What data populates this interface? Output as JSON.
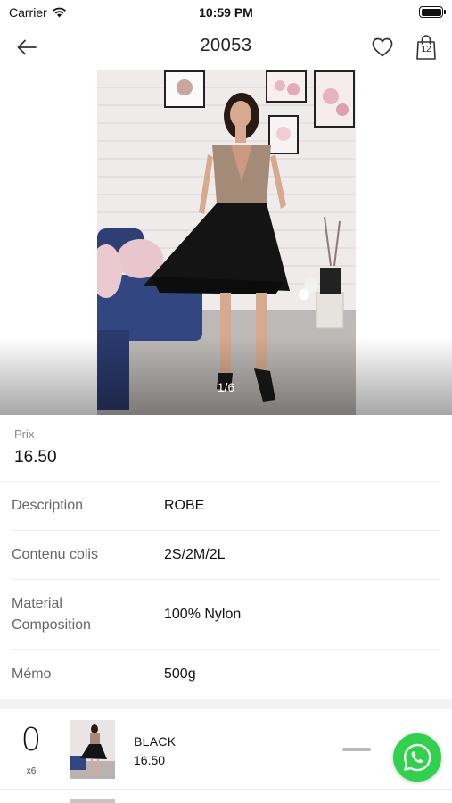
{
  "status_bar": {
    "carrier": "Carrier",
    "time": "10:59 PM"
  },
  "nav": {
    "title": "20053",
    "cart_count": "12"
  },
  "gallery": {
    "counter": "1/6"
  },
  "product": {
    "price_label": "Prix",
    "price_value": "16.50",
    "attributes": [
      {
        "key": "Description",
        "value": "ROBE"
      },
      {
        "key": "Contenu colis",
        "value": "2S/2M/2L"
      },
      {
        "key": "Material Composition",
        "value": "100% Nylon"
      },
      {
        "key": "Mémo",
        "value": "500g"
      }
    ]
  },
  "variants": [
    {
      "quantity": "0",
      "multiplier": "x6",
      "color": "BLACK",
      "price": "16.50"
    }
  ],
  "colors": {
    "whatsapp": "#2fd14d",
    "divider": "#ececec",
    "label": "#666666"
  }
}
